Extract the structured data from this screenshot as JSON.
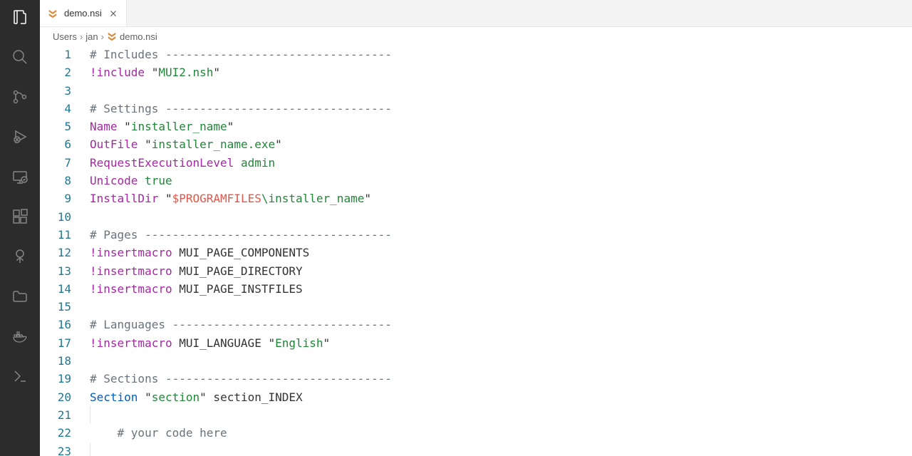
{
  "activity_bar": {
    "items": [
      "explorer",
      "search",
      "source-control",
      "run-debug",
      "remote",
      "extensions",
      "garden",
      "folder",
      "docker",
      "terminal"
    ]
  },
  "tab": {
    "filename": "demo.nsi"
  },
  "breadcrumbs": {
    "segments": [
      "Users",
      "jan",
      "demo.nsi"
    ]
  },
  "code": {
    "lines": [
      {
        "n": 1,
        "t": [
          {
            "c": "c-comment",
            "v": "# Includes ---------------------------------"
          }
        ]
      },
      {
        "n": 2,
        "t": [
          {
            "c": "c-keyword",
            "v": "!include"
          },
          {
            "c": "",
            "v": " "
          },
          {
            "c": "c-quote",
            "v": "\""
          },
          {
            "c": "c-string",
            "v": "MUI2.nsh"
          },
          {
            "c": "c-quote",
            "v": "\""
          }
        ]
      },
      {
        "n": 3,
        "t": []
      },
      {
        "n": 4,
        "t": [
          {
            "c": "c-comment",
            "v": "# Settings ---------------------------------"
          }
        ]
      },
      {
        "n": 5,
        "t": [
          {
            "c": "c-keyword",
            "v": "Name"
          },
          {
            "c": "",
            "v": " "
          },
          {
            "c": "c-quote",
            "v": "\""
          },
          {
            "c": "c-string",
            "v": "installer_name"
          },
          {
            "c": "c-quote",
            "v": "\""
          }
        ]
      },
      {
        "n": 6,
        "t": [
          {
            "c": "c-keyword",
            "v": "OutFile"
          },
          {
            "c": "",
            "v": " "
          },
          {
            "c": "c-quote",
            "v": "\""
          },
          {
            "c": "c-string",
            "v": "installer_name.exe"
          },
          {
            "c": "c-quote",
            "v": "\""
          }
        ]
      },
      {
        "n": 7,
        "t": [
          {
            "c": "c-keyword",
            "v": "RequestExecutionLevel"
          },
          {
            "c": "",
            "v": " "
          },
          {
            "c": "c-string",
            "v": "admin"
          }
        ]
      },
      {
        "n": 8,
        "t": [
          {
            "c": "c-keyword",
            "v": "Unicode"
          },
          {
            "c": "",
            "v": " "
          },
          {
            "c": "c-string",
            "v": "true"
          }
        ]
      },
      {
        "n": 9,
        "t": [
          {
            "c": "c-keyword",
            "v": "InstallDir"
          },
          {
            "c": "",
            "v": " "
          },
          {
            "c": "c-quote",
            "v": "\""
          },
          {
            "c": "c-variable",
            "v": "$PROGRAMFILES"
          },
          {
            "c": "c-string",
            "v": "\\installer_name"
          },
          {
            "c": "c-quote",
            "v": "\""
          }
        ]
      },
      {
        "n": 10,
        "t": []
      },
      {
        "n": 11,
        "t": [
          {
            "c": "c-comment",
            "v": "# Pages ------------------------------------"
          }
        ]
      },
      {
        "n": 12,
        "t": [
          {
            "c": "c-keyword",
            "v": "!insertmacro"
          },
          {
            "c": "",
            "v": " MUI_PAGE_COMPONENTS"
          }
        ]
      },
      {
        "n": 13,
        "t": [
          {
            "c": "c-keyword",
            "v": "!insertmacro"
          },
          {
            "c": "",
            "v": " MUI_PAGE_DIRECTORY"
          }
        ]
      },
      {
        "n": 14,
        "t": [
          {
            "c": "c-keyword",
            "v": "!insertmacro"
          },
          {
            "c": "",
            "v": " MUI_PAGE_INSTFILES"
          }
        ]
      },
      {
        "n": 15,
        "t": []
      },
      {
        "n": 16,
        "t": [
          {
            "c": "c-comment",
            "v": "# Languages --------------------------------"
          }
        ]
      },
      {
        "n": 17,
        "t": [
          {
            "c": "c-keyword",
            "v": "!insertmacro"
          },
          {
            "c": "",
            "v": " MUI_LANGUAGE "
          },
          {
            "c": "c-quote",
            "v": "\""
          },
          {
            "c": "c-string",
            "v": "English"
          },
          {
            "c": "c-quote",
            "v": "\""
          }
        ]
      },
      {
        "n": 18,
        "t": []
      },
      {
        "n": 19,
        "t": [
          {
            "c": "c-comment",
            "v": "# Sections ---------------------------------"
          }
        ]
      },
      {
        "n": 20,
        "t": [
          {
            "c": "c-section",
            "v": "Section"
          },
          {
            "c": "",
            "v": " "
          },
          {
            "c": "c-quote",
            "v": "\""
          },
          {
            "c": "c-string",
            "v": "section"
          },
          {
            "c": "c-quote",
            "v": "\""
          },
          {
            "c": "",
            "v": " section_INDEX"
          }
        ]
      },
      {
        "n": 21,
        "t": [],
        "indent": true
      },
      {
        "n": 22,
        "t": [
          {
            "c": "",
            "v": "    "
          },
          {
            "c": "c-comment",
            "v": "# your code here"
          }
        ],
        "indent": true
      },
      {
        "n": 23,
        "t": [],
        "indent": true
      }
    ]
  }
}
